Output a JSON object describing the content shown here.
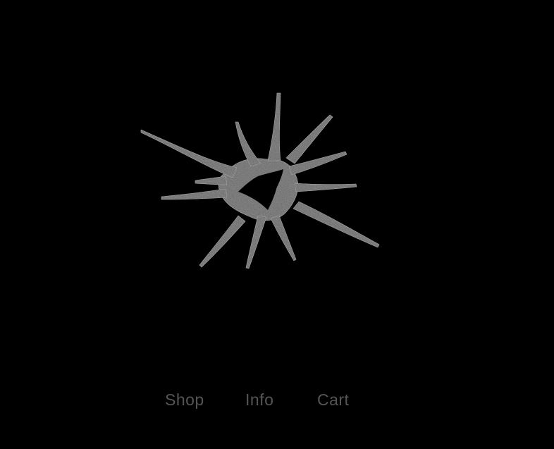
{
  "logo": {
    "icon": "starburst-logo-icon",
    "color": "#4a4a4a",
    "highlight": "#9a9a9a"
  },
  "nav": {
    "items": [
      {
        "label": "Shop"
      },
      {
        "label": "Info"
      },
      {
        "label": "Cart"
      }
    ],
    "text_color": "#555555"
  },
  "background": "#000000"
}
